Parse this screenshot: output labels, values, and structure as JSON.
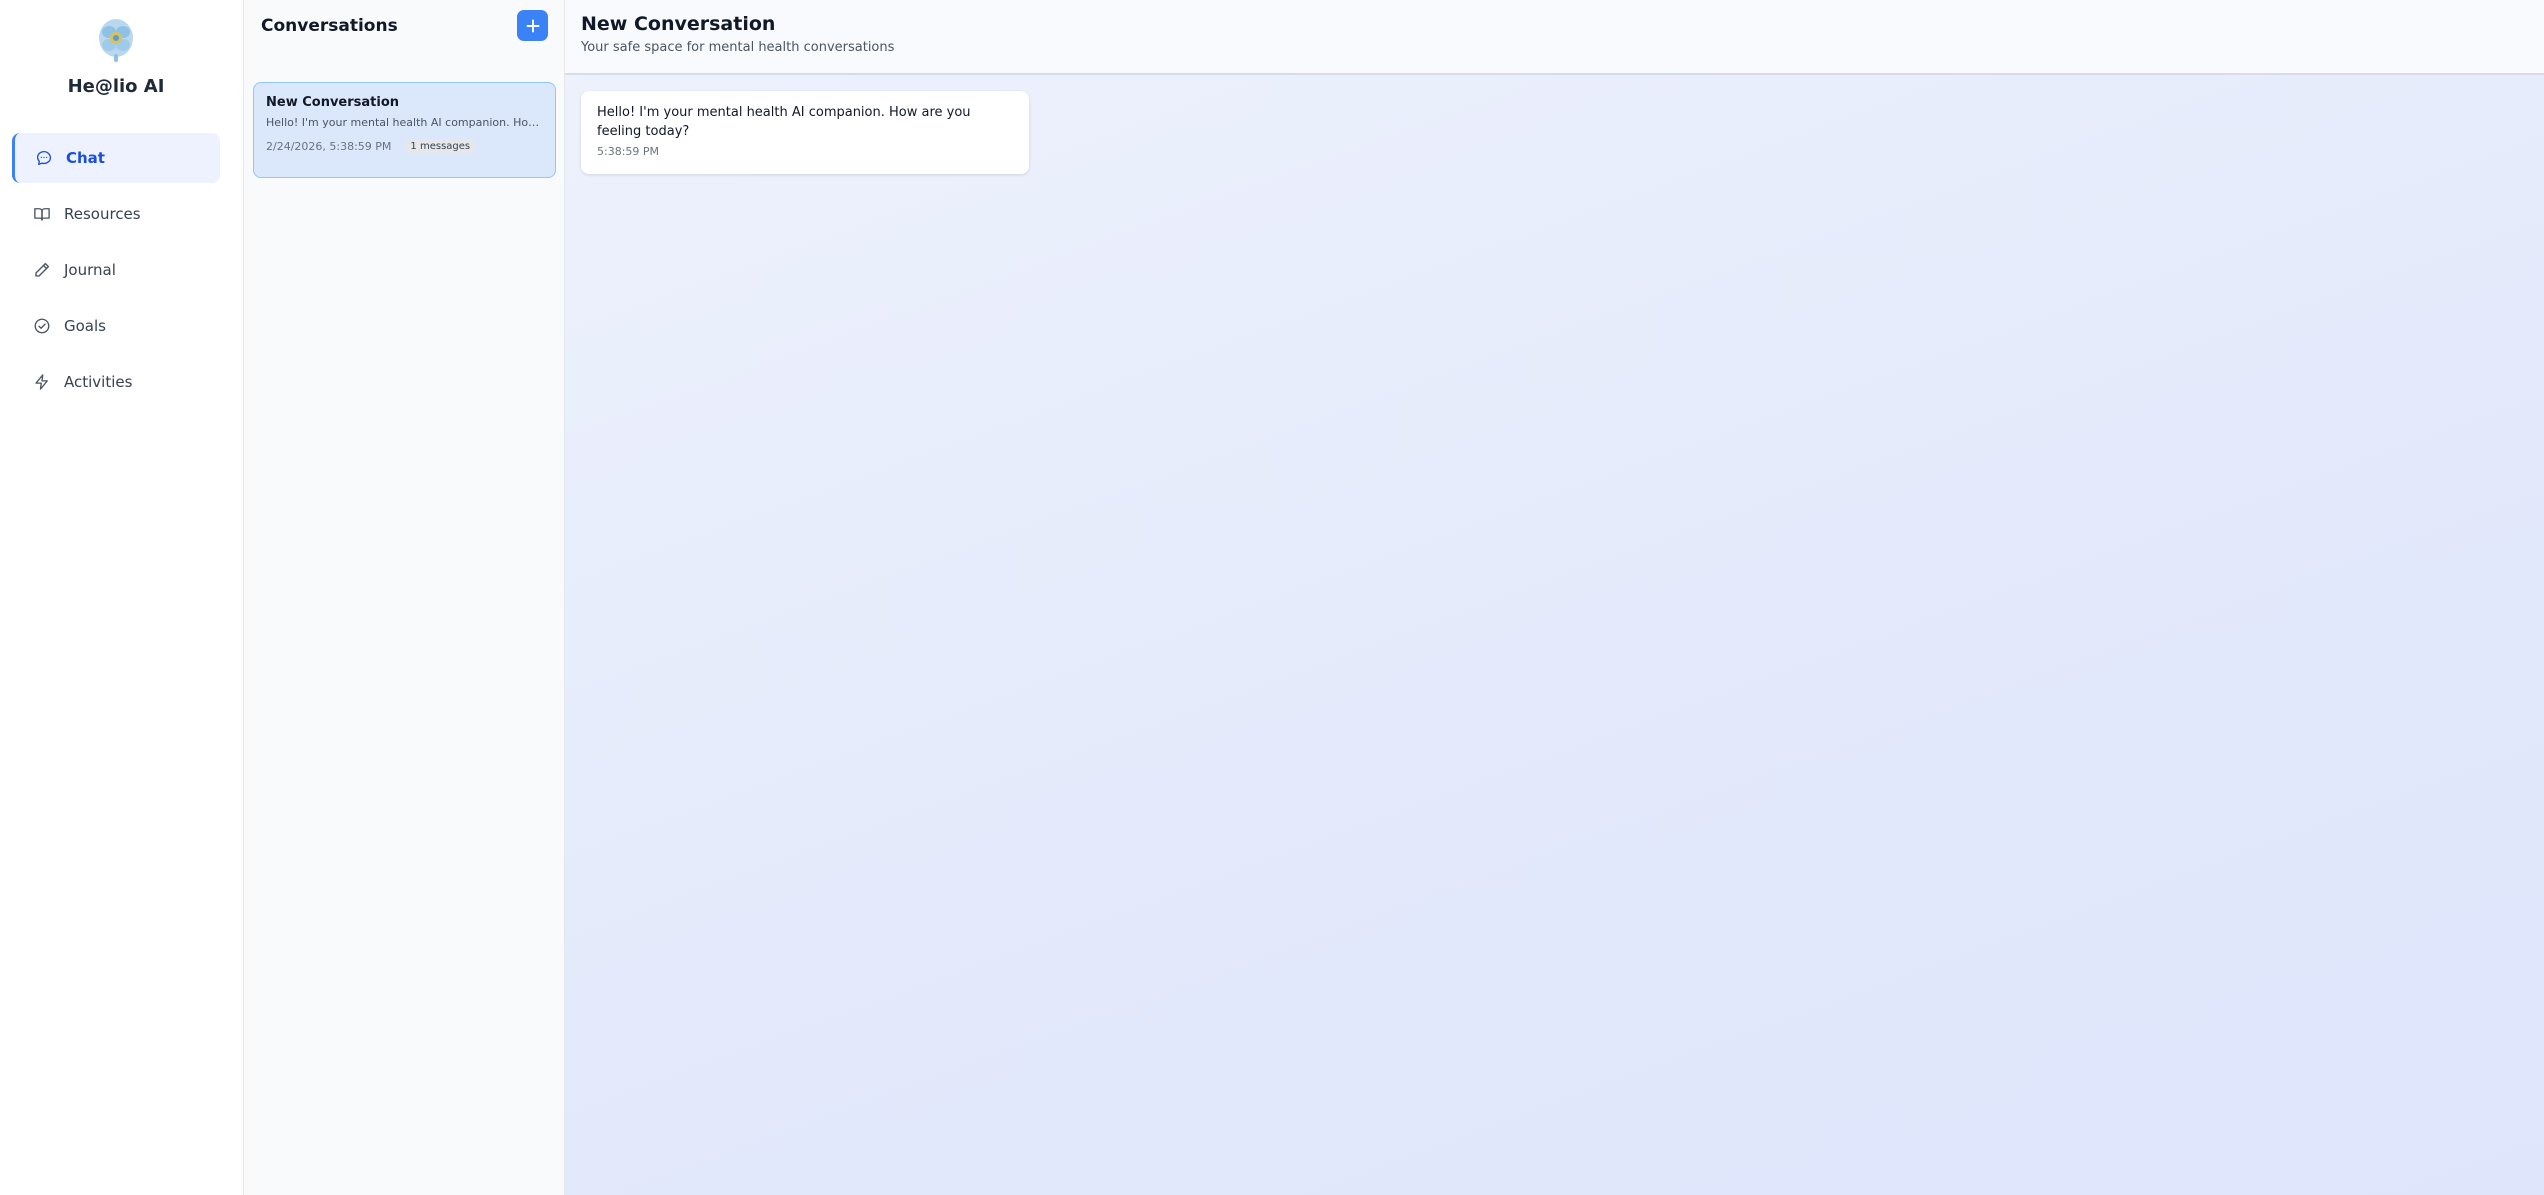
{
  "app": {
    "name": "He@lio AI",
    "logo_icon": "brain-logo-icon"
  },
  "nav": {
    "items": [
      {
        "label": "Chat",
        "icon": "chat-bubble-icon",
        "active": true
      },
      {
        "label": "Resources",
        "icon": "book-icon",
        "active": false
      },
      {
        "label": "Journal",
        "icon": "pencil-icon",
        "active": false
      },
      {
        "label": "Goals",
        "icon": "check-circle-icon",
        "active": false
      },
      {
        "label": "Activities",
        "icon": "lightning-icon",
        "active": false
      }
    ]
  },
  "conversations": {
    "title": "Conversations",
    "new_button_icon": "plus-icon",
    "items": [
      {
        "title": "New Conversation",
        "preview": "Hello! I'm your mental health AI companion. How a...",
        "timestamp": "2/24/2026, 5:38:59 PM",
        "count": "1 messages",
        "selected": true
      }
    ]
  },
  "chat": {
    "title": "New Conversation",
    "subtitle": "Your safe space for mental health conversations",
    "messages": [
      {
        "text": "Hello! I'm your mental health AI companion. How are you feeling today?",
        "time": "5:38:59 PM"
      }
    ]
  },
  "colors": {
    "accent": "#3b82f6",
    "active_text": "#1d4ed8",
    "selected_card": "#dbe7fb"
  }
}
